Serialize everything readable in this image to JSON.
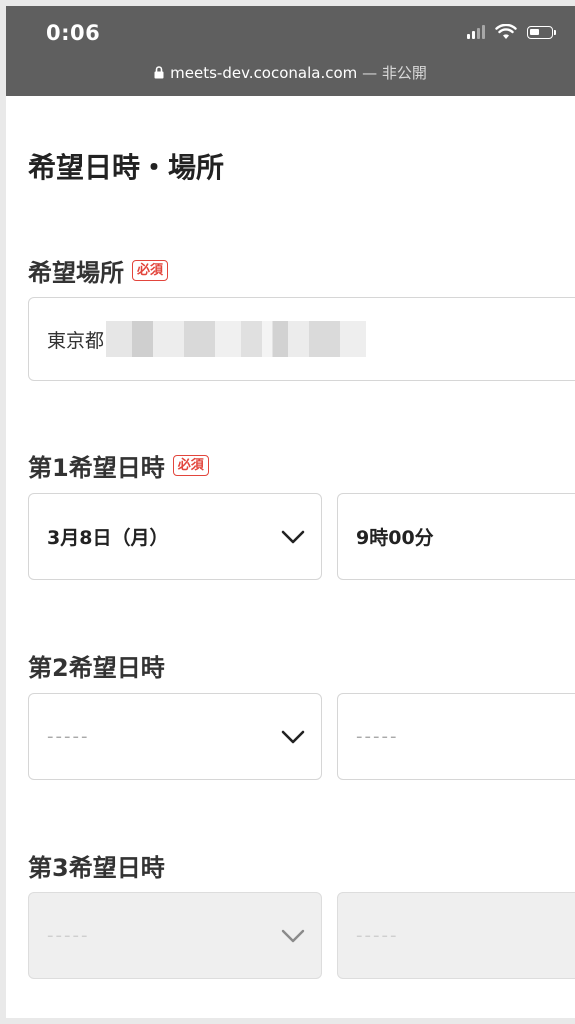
{
  "status_bar": {
    "time": "0:06",
    "url": "meets-dev.coconala.com",
    "private_label": "— 非公開"
  },
  "page": {
    "title": "希望日時・場所"
  },
  "location": {
    "label": "希望場所",
    "required_badge": "必須",
    "value_prefix": "東京都"
  },
  "choice1": {
    "label": "第1希望日時",
    "required_badge": "必須",
    "date": "3月8日（月）",
    "time": "9時00分"
  },
  "choice2": {
    "label": "第2希望日時",
    "date_placeholder": "-----",
    "time_placeholder": "-----"
  },
  "choice3": {
    "label": "第3希望日時",
    "date_placeholder": "-----",
    "time_placeholder": "-----"
  },
  "colors": {
    "status_bar_bg": "#5f5f5f",
    "required_red": "#e2453c",
    "field_border": "#d6d6d6",
    "disabled_bg": "#efefef"
  }
}
